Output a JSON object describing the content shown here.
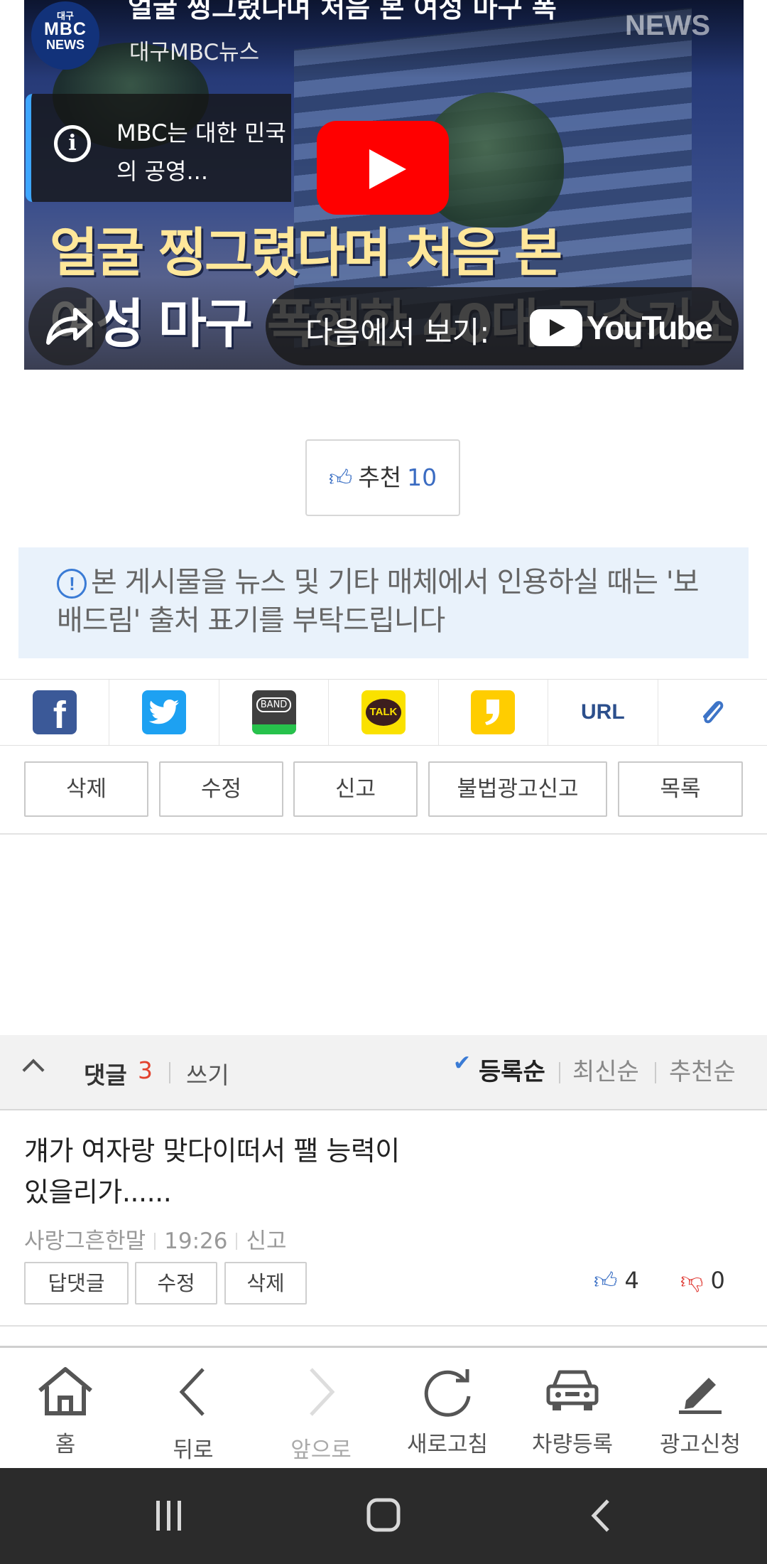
{
  "video": {
    "channel_logo_lines": [
      "대구",
      "MBC",
      "NEWS"
    ],
    "title": "얼굴 찡그렸다며 처음 본 여성 마구 폭",
    "channel_name": "대구MBC뉴스",
    "watermark": "NEWS",
    "info_text": "MBC는 대한 민국의 공영...",
    "headline_line1": "얼굴 찡그렸다며 처음 본",
    "headline_line2": "여성 마구 폭행한 40대 구속기소",
    "watch_on_label": "다음에서 보기:",
    "youtube_wordmark": "YouTube"
  },
  "recommend": {
    "label": "추천",
    "count": "10"
  },
  "notice": {
    "text": "본 게시물을 뉴스 및 기타 매체에서 인용하실 때는 '보배드림' 출처 표기를 부탁드립니다"
  },
  "share": {
    "items": [
      {
        "name": "facebook",
        "glyph": "f"
      },
      {
        "name": "twitter",
        "glyph": ""
      },
      {
        "name": "band",
        "glyph": "BAND"
      },
      {
        "name": "kakaotalk",
        "glyph": "TALK"
      },
      {
        "name": "kakaostory",
        "glyph": ""
      },
      {
        "name": "url",
        "glyph": "URL"
      },
      {
        "name": "clip",
        "glyph": ""
      }
    ]
  },
  "actions": {
    "delete": "삭제",
    "edit": "수정",
    "report": "신고",
    "illegal_ad_report": "불법광고신고",
    "list": "목록"
  },
  "comments": {
    "label": "댓글",
    "count": "3",
    "write": "쓰기",
    "sort": {
      "registered": "등록순",
      "latest": "최신순",
      "recommended": "추천순"
    },
    "items": [
      {
        "text": "걔가 여자랑 맞다이떠서 팰 능력이 있을리가......",
        "author": "사랑그흔한말",
        "time": "19:26",
        "report": "신고",
        "reply": "답댓글",
        "edit": "수정",
        "delete": "삭제",
        "likes": "4",
        "dislikes": "0"
      }
    ]
  },
  "bottom_nav": {
    "home": "홈",
    "back": "뒤로",
    "forward": "앞으로",
    "refresh": "새로고침",
    "car_register": "차량등록",
    "ad_apply": "광고신청"
  },
  "colors": {
    "accent_blue": "#3a7bd5",
    "count_red": "#e2412d",
    "youtube_red": "#ff0000",
    "notice_bg": "#e9f2fb"
  }
}
